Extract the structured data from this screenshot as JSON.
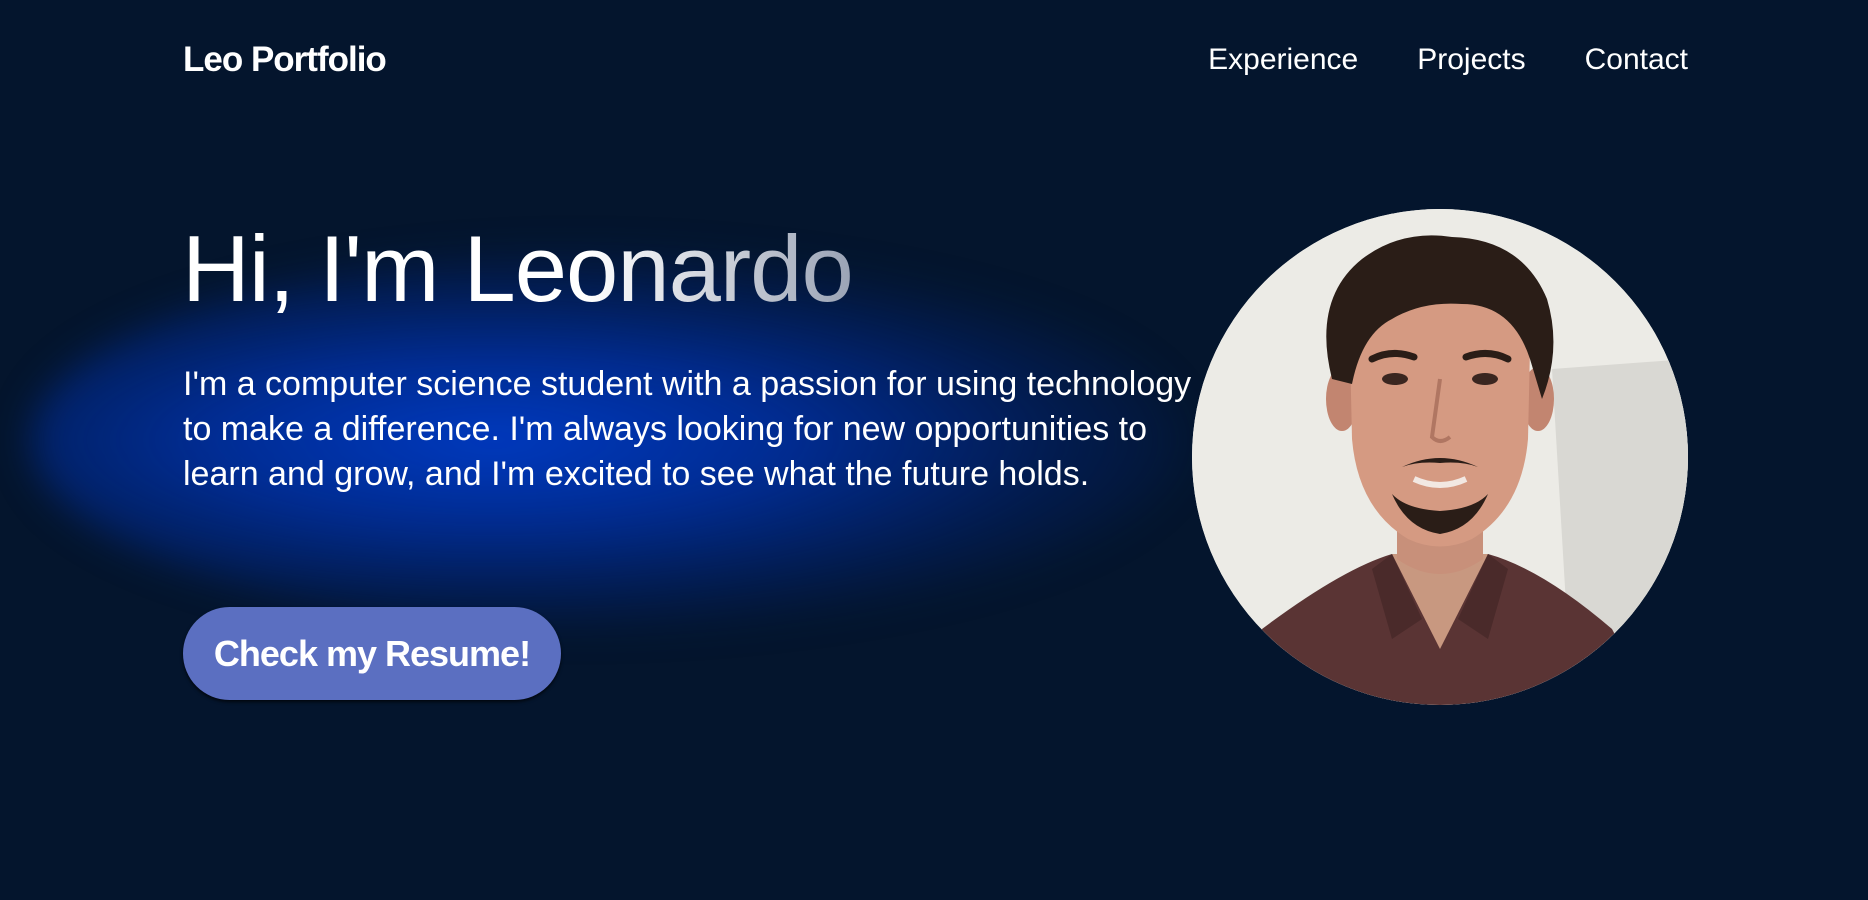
{
  "nav": {
    "brand": "Leo Portfolio",
    "links": [
      "Experience",
      "Projects",
      "Contact"
    ]
  },
  "hero": {
    "title": "Hi, I'm Leonardo",
    "description": "I'm a computer science student with a passion for using technology to make a difference. I'm always looking for new opportunities to learn and grow, and I'm excited to see what the future holds.",
    "cta_label": "Check my Resume!"
  },
  "colors": {
    "background": "#04152d",
    "glow": "#0037c0",
    "button": "#5b6fc1",
    "text": "#ffffff"
  },
  "icons": {
    "avatar": "profile-photo"
  }
}
